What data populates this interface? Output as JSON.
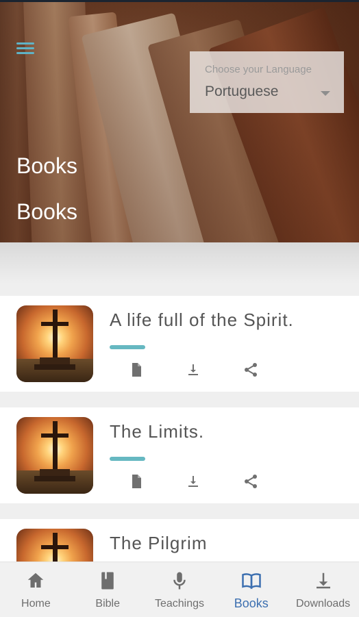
{
  "header": {
    "title": "Books",
    "subtitle": "Books",
    "language_label": "Choose your Language",
    "language_value": "Portuguese"
  },
  "books": [
    {
      "title": "A life full of the Spirit."
    },
    {
      "title": "The Limits."
    },
    {
      "title": "The Pilgrim"
    }
  ],
  "card_actions": [
    "document-icon",
    "download-icon",
    "share-icon"
  ],
  "nav": {
    "items": [
      {
        "label": "Home",
        "icon": "home-icon"
      },
      {
        "label": "Bible",
        "icon": "bible-icon"
      },
      {
        "label": "Teachings",
        "icon": "microphone-icon"
      },
      {
        "label": "Books",
        "icon": "open-book-icon",
        "active": true
      },
      {
        "label": "Downloads",
        "icon": "download-icon"
      }
    ]
  },
  "colors": {
    "accent": "#5fb3c6",
    "underline": "#66b8c1",
    "nav_active": "#3c6fb0",
    "nav_inactive": "#6e6e6e"
  }
}
